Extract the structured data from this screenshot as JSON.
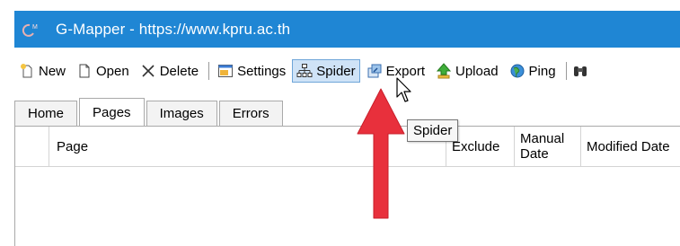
{
  "window": {
    "title": "G-Mapper - https://www.kpru.ac.th",
    "accent": "#1f86d4"
  },
  "toolbar": {
    "new_label": "New",
    "open_label": "Open",
    "delete_label": "Delete",
    "settings_label": "Settings",
    "spider_label": "Spider",
    "export_label": "Export",
    "upload_label": "Upload",
    "ping_label": "Ping"
  },
  "tabs": [
    {
      "label": "Home"
    },
    {
      "label": "Pages",
      "selected": true
    },
    {
      "label": "Images"
    },
    {
      "label": "Errors"
    }
  ],
  "grid": {
    "columns": [
      "Page",
      "Exclude",
      "Manual Date",
      "Modified Date"
    ]
  },
  "tooltip": {
    "text": "Spider"
  },
  "annotation": {
    "arrow_color": "#e8303c"
  }
}
